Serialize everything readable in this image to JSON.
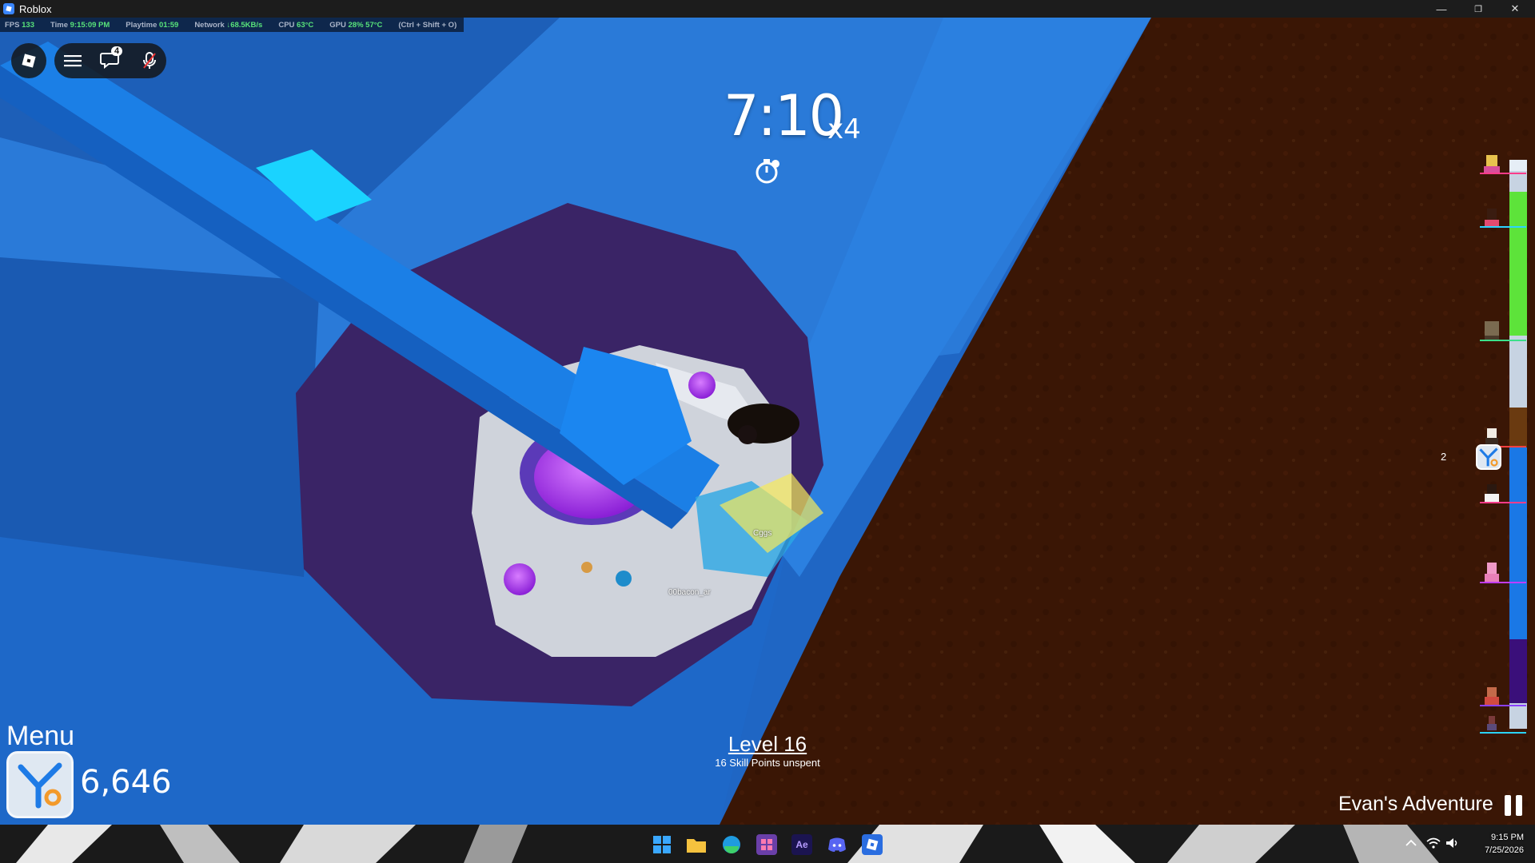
{
  "window": {
    "title": "Roblox",
    "minimize": "—",
    "restore": "❐",
    "close": "✕"
  },
  "stats": {
    "fps_label": "FPS",
    "fps": "133",
    "time_label": "Time",
    "time": "9:15:09 PM",
    "playtime_label": "Playtime",
    "playtime": "01:59",
    "network_label": "Network",
    "network": "↓68.5KB/s",
    "cpu_label": "CPU",
    "cpu": "63°C",
    "gpu_label": "GPU",
    "gpu": "28%",
    "gpu_temp": "57°C",
    "shortcut": "(Ctrl + Shift + O)"
  },
  "topleft": {
    "chat_badge": "4",
    "icons": [
      "roblox-logo-icon",
      "hamburger-menu-icon",
      "chat-icon",
      "microphone-icon"
    ]
  },
  "hud": {
    "timer": "7:10",
    "multiplier": "x4",
    "level": "Level 16",
    "skill_points": "16 Skill Points unspent",
    "menu": "Menu",
    "currency": "6,646",
    "game_name": "Evan's Adventure",
    "side_count": "2"
  },
  "world_labels": {
    "player_a": "Cggs",
    "player_b": "00bacon_ar"
  },
  "taskbar": {
    "apps": [
      "windows-start-icon",
      "file-explorer-icon",
      "edge-icon",
      "app-icon",
      "after-effects-icon",
      "discord-icon",
      "roblox-icon"
    ],
    "ae_label": "Ae",
    "time": "9:15 PM",
    "date": "7/25/2026"
  },
  "colors": {
    "sky_blue": "#1f66c4",
    "dirt": "#3a1605",
    "accent_cyan": "#1ad3ff",
    "purple_orb": "#b23bff"
  }
}
